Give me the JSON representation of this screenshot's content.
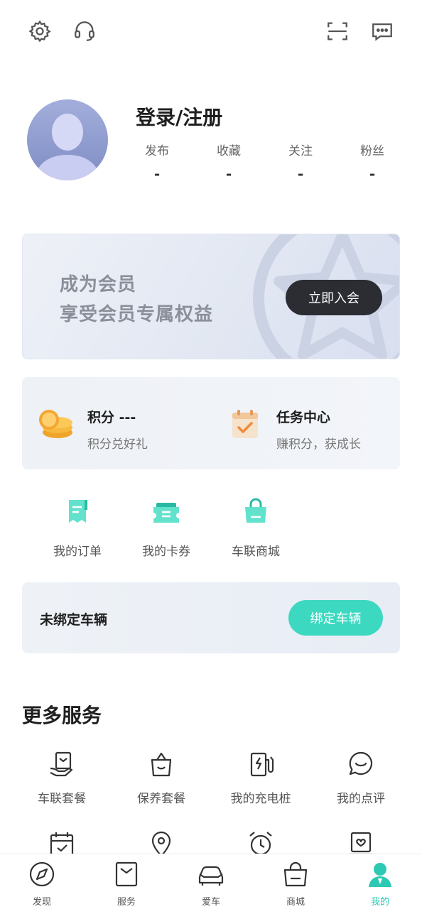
{
  "topbar": {
    "left_icons": [
      "gear-icon",
      "headset-icon"
    ],
    "right_icons": [
      "scan-icon",
      "message-icon"
    ]
  },
  "profile": {
    "login_label": "登录/注册",
    "stats": [
      {
        "label": "发布",
        "value": "-"
      },
      {
        "label": "收藏",
        "value": "-"
      },
      {
        "label": "关注",
        "value": "-"
      },
      {
        "label": "粉丝",
        "value": "-"
      }
    ]
  },
  "member": {
    "line1": "成为会员",
    "line2": "享受会员专属权益",
    "join_label": "立即入会"
  },
  "points": {
    "points_title": "积分 ---",
    "points_sub": "积分兑好礼",
    "tasks_title": "任务中心",
    "tasks_sub": "赚积分，获成长"
  },
  "quick": [
    {
      "label": "我的订单",
      "icon": "order-icon"
    },
    {
      "label": "我的卡券",
      "icon": "coupon-icon"
    },
    {
      "label": "车联商城",
      "icon": "shopping-bag-icon"
    }
  ],
  "vehicle": {
    "status": "未绑定车辆",
    "bind_label": "绑定车辆"
  },
  "more_services": {
    "title": "更多服务",
    "items": [
      {
        "label": "车联套餐",
        "icon": "package-hand-icon"
      },
      {
        "label": "保养套餐",
        "icon": "maintenance-bag-icon"
      },
      {
        "label": "我的充电桩",
        "icon": "charger-icon"
      },
      {
        "label": "我的点评",
        "icon": "comment-icon"
      },
      {
        "label": "",
        "icon": "calendar-check-icon"
      },
      {
        "label": "",
        "icon": "location-pin-icon"
      },
      {
        "label": "",
        "icon": "alarm-clock-icon"
      },
      {
        "label": "",
        "icon": "certificate-icon"
      }
    ]
  },
  "tabbar": {
    "items": [
      {
        "label": "发现",
        "icon": "compass-icon"
      },
      {
        "label": "服务",
        "icon": "service-icon"
      },
      {
        "label": "爱车",
        "icon": "car-icon"
      },
      {
        "label": "商城",
        "icon": "shop-icon"
      },
      {
        "label": "我的",
        "icon": "person-icon",
        "active": true
      }
    ]
  },
  "colors": {
    "accent": "#3dd8c0",
    "active_tab": "#2ec9b3",
    "dark_button": "#2b2d33"
  }
}
